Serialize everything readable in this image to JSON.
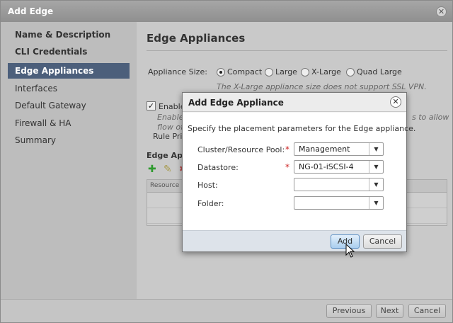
{
  "window": {
    "title": "Add Edge",
    "close_glyph": "✕"
  },
  "nav": {
    "items": [
      {
        "label": "Name & Description",
        "state": "bold"
      },
      {
        "label": "CLI Credentials",
        "state": "bold"
      },
      {
        "label": "Edge Appliances",
        "state": "active"
      },
      {
        "label": "Interfaces",
        "state": "normal"
      },
      {
        "label": "Default Gateway",
        "state": "normal"
      },
      {
        "label": "Firewall & HA",
        "state": "normal"
      },
      {
        "label": "Summary",
        "state": "normal"
      }
    ]
  },
  "content": {
    "title": "Edge Appliances",
    "appliance_size_label": "Appliance Size:",
    "size_options": [
      {
        "label": "Compact",
        "selected": true
      },
      {
        "label": "Large",
        "selected": false
      },
      {
        "label": "X-Large",
        "selected": false
      },
      {
        "label": "Quad Large",
        "selected": false
      }
    ],
    "size_note": "The X-Large appliance size does not support SSL VPN.",
    "enable_label": "Enable",
    "enable_checked": true,
    "enable_desc_line1": "Enable",
    "enable_desc_line2": "flow of",
    "right_note": "s to allow",
    "rule_label": "Rule Pri",
    "appliances_label": "Edge App",
    "grid_header": "Resource P"
  },
  "footer": {
    "previous_label": "Previous",
    "next_label": "Next",
    "cancel_label": "Cancel"
  },
  "modal": {
    "title": "Add Edge Appliance",
    "close_glyph": "✕",
    "instruction": "Specify the placement parameters for the Edge appliance.",
    "fields": {
      "cluster": {
        "label": "Cluster/Resource Pool:",
        "value": "Management",
        "required": true
      },
      "datastore": {
        "label": "Datastore:",
        "value": "NG-01-iSCSI-4",
        "required": true
      },
      "host": {
        "label": "Host:",
        "value": "",
        "required": false
      },
      "folder": {
        "label": "Folder:",
        "value": "",
        "required": false
      }
    },
    "required_glyph": "*",
    "add_label": "Add",
    "cancel_label": "Cancel"
  },
  "icons": {
    "add": "✚",
    "edit": "✎",
    "delete": "✖",
    "dropdown": "▼",
    "check": "✓"
  },
  "colors": {
    "active_nav": "#4c5f7b",
    "required": "#cc2222",
    "add_icon": "#2e9a2e",
    "primary_button": "#a9cdee"
  }
}
